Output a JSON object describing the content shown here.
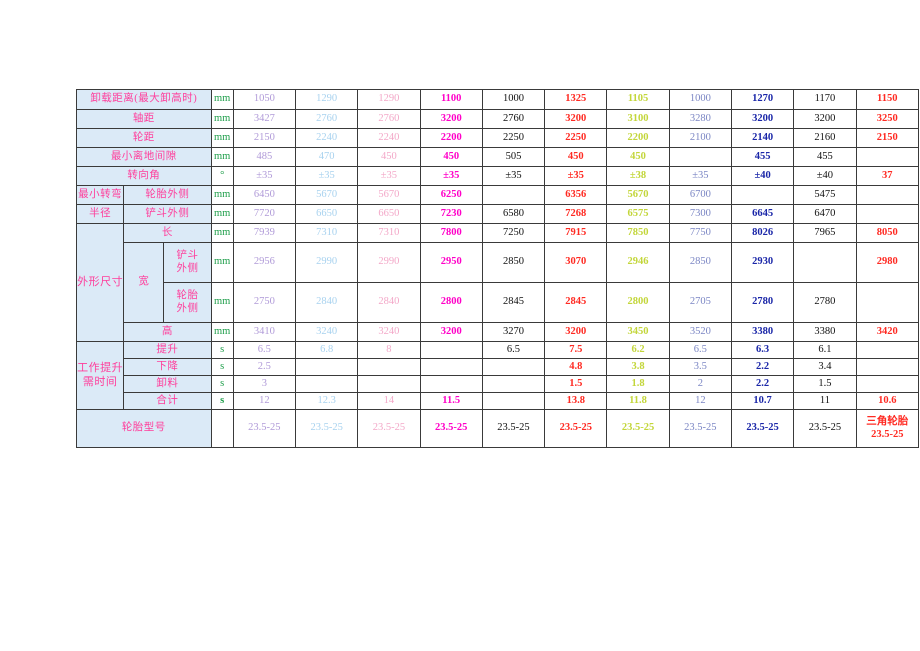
{
  "table": {
    "column_colors": [
      "#b09ad8",
      "#a8d2ef",
      "#f3a8c8",
      "#ff00c8",
      "#111111",
      "#ff2a22",
      "#c3d63a",
      "#7b86c4",
      "#1a26a8",
      "#111111",
      "#ff2a22"
    ],
    "label_color": "#ff3d9b",
    "label_bg": "#dbeaf7",
    "unit_color": "#1e9e4a",
    "labels": {
      "unload_distance": "卸载距离(最大卸高时)",
      "wheelbase": "轴距",
      "track": "轮距",
      "min_ground_clearance": "最小离地间隙",
      "steering_angle": "转向角",
      "min_turn_radius": "最小转弯",
      "min_turn_radius_2": "半径",
      "tire_outside": "轮胎外侧",
      "bucket_outside": "铲斗外侧",
      "overall_dims": "外形尺寸",
      "length": "长",
      "width": "宽",
      "width_bucket_outside_1": "铲斗",
      "width_bucket_outside_2": "外侧",
      "width_tire_outside_1": "轮胎",
      "width_tire_outside_2": "外侧",
      "height": "高",
      "work_lift_time_1": "工作提升",
      "work_lift_time_2": "需时间",
      "lift": "提升",
      "lower": "下降",
      "dump": "卸料",
      "total": "合计",
      "tire_model": "轮胎型号"
    },
    "units": {
      "mm": "mm",
      "deg": "°",
      "s": "s",
      "s_bold": "s"
    },
    "rows": [
      {
        "key": "unload_distance",
        "unit": "mm",
        "values": [
          "1050",
          "3427",
          "2150",
          "485",
          "±35"
        ]
      },
      {
        "key": "wheelbase",
        "unit": "mm"
      }
    ],
    "data": {
      "unload_distance": [
        "1050",
        "1290",
        "1290",
        "1100",
        "1000",
        "1325",
        "1105",
        "1000",
        "1270",
        "1170",
        "1150"
      ],
      "wheelbase": [
        "3427",
        "2760",
        "2760",
        "3200",
        "2760",
        "3200",
        "3100",
        "3280",
        "3200",
        "3200",
        "3250"
      ],
      "track": [
        "2150",
        "2240",
        "2240",
        "2200",
        "2250",
        "2250",
        "2200",
        "2100",
        "2140",
        "2160",
        "2150"
      ],
      "min_ground_clearance": [
        "485",
        "470",
        "450",
        "450",
        "505",
        "450",
        "450",
        "",
        "455",
        "455",
        ""
      ],
      "steering_angle": [
        "±35",
        "±35",
        "±35",
        "±35",
        "±35",
        "±35",
        "±38",
        "±35",
        "±40",
        "±40",
        "37"
      ],
      "turn_tire_outside": [
        "6450",
        "5670",
        "5670",
        "6250",
        "",
        "6356",
        "5670",
        "6700",
        "",
        "5475",
        ""
      ],
      "turn_bucket_outside": [
        "7720",
        "6650",
        "6650",
        "7230",
        "6580",
        "7268",
        "6575",
        "7300",
        "6645",
        "6470",
        ""
      ],
      "length": [
        "7939",
        "7310",
        "7310",
        "7800",
        "7250",
        "7915",
        "7850",
        "7750",
        "8026",
        "7965",
        "8050"
      ],
      "width_bucket_outside": [
        "2956",
        "2990",
        "2990",
        "2950",
        "2850",
        "3070",
        "2946",
        "2850",
        "2930",
        "",
        "2980"
      ],
      "width_tire_outside": [
        "2750",
        "2840",
        "2840",
        "2800",
        "2845",
        "2845",
        "2800",
        "2705",
        "2780",
        "2780",
        ""
      ],
      "height": [
        "3410",
        "3240",
        "3240",
        "3200",
        "3270",
        "3200",
        "3450",
        "3520",
        "3380",
        "3380",
        "3420"
      ],
      "lift": [
        "6.5",
        "6.8",
        "8",
        "",
        "6.5",
        "7.5",
        "6.2",
        "6.5",
        "6.3",
        "6.1",
        ""
      ],
      "lower": [
        "2.5",
        "",
        "",
        "",
        "",
        "4.8",
        "3.8",
        "3.5",
        "2.2",
        "3.4",
        ""
      ],
      "dump": [
        "3",
        "",
        "",
        "",
        "",
        "1.5",
        "1.8",
        "2",
        "2.2",
        "1.5",
        ""
      ],
      "total": [
        "12",
        "12.3",
        "14",
        "11.5",
        "",
        "13.8",
        "11.8",
        "12",
        "10.7",
        "11",
        "10.6"
      ],
      "tire_model": [
        "23.5-25",
        "23.5-25",
        "23.5-25",
        "23.5-25",
        "23.5-25",
        "23.5-25",
        "23.5-25",
        "23.5-25",
        "23.5-25",
        "23.5-25",
        ""
      ],
      "tire_model_last_line1": "三角轮胎",
      "tire_model_last_line2": "23.5-25"
    }
  }
}
